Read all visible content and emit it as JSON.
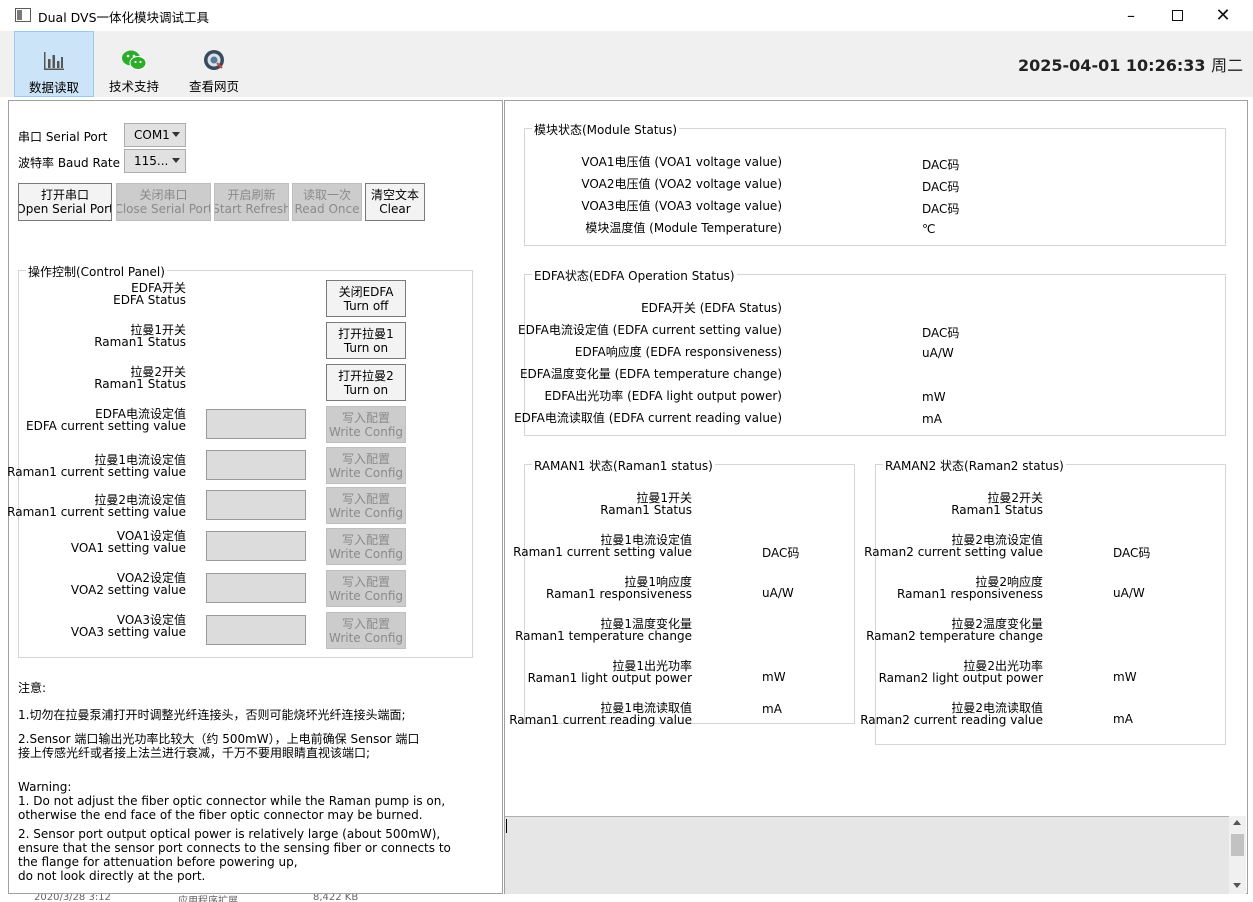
{
  "window": {
    "title": "Dual DVS一体化模块调试工具",
    "minimize_icon": "minimize-icon",
    "maximize_icon": "maximize-icon",
    "close_icon": "close-icon"
  },
  "toolbar": {
    "items": [
      {
        "label": "数据读取",
        "icon": "bar-chart-icon"
      },
      {
        "label": "技术支持",
        "icon": "wechat-icon"
      },
      {
        "label": "查看网页",
        "icon": "web-icon"
      }
    ],
    "datetime": "2025-04-01 10:26:33",
    "weekday": "周二"
  },
  "serial": {
    "port_label": "串口 Serial Port",
    "port_value": "COM1",
    "baud_label": "波特率 Baud Rate",
    "baud_value": "115...",
    "buttons": [
      {
        "cn": "打开串口",
        "en": "Open Serial Port",
        "enabled": true
      },
      {
        "cn": "关闭串口",
        "en": "Close Serial Port",
        "enabled": false
      },
      {
        "cn": "开启刷新",
        "en": "Start Refresh",
        "enabled": false
      },
      {
        "cn": "读取一次",
        "en": "Read Once",
        "enabled": false
      },
      {
        "cn": "清空文本",
        "en": "Clear",
        "enabled": true
      }
    ]
  },
  "control": {
    "title": "操作控制(Control Panel)",
    "toggles": [
      {
        "cn": "EDFA开关",
        "en": "EDFA Status",
        "btn_cn": "关闭EDFA",
        "btn_en": "Turn off"
      },
      {
        "cn": "拉曼1开关",
        "en": "Raman1 Status",
        "btn_cn": "打开拉曼1",
        "btn_en": "Turn on"
      },
      {
        "cn": "拉曼2开关",
        "en": "Raman1 Status",
        "btn_cn": "打开拉曼2",
        "btn_en": "Turn on"
      }
    ],
    "settings": [
      {
        "cn": "EDFA电流设定值",
        "en": "EDFA current setting value",
        "value": ""
      },
      {
        "cn": "拉曼1电流设定值",
        "en": "Raman1 current setting value",
        "value": ""
      },
      {
        "cn": "拉曼2电流设定值",
        "en": "Raman1 current setting value",
        "value": ""
      },
      {
        "cn": "VOA1设定值",
        "en": "VOA1 setting value",
        "value": ""
      },
      {
        "cn": "VOA2设定值",
        "en": "VOA2 setting value",
        "value": ""
      },
      {
        "cn": "VOA3设定值",
        "en": "VOA3 setting value",
        "value": ""
      }
    ],
    "write_cn": "写入配置",
    "write_en": "Write Config"
  },
  "notes": {
    "head": "注意:",
    "cn1": "1.切勿在拉曼泵浦打开时调整光纤连接头，否则可能烧坏光纤连接头端面;",
    "cn2a": "2.Sensor 端口输出光功率比较大（约 500mW），上电前确保 Sensor 端口",
    "cn2b": "接上传感光纤或者接上法兰进行衰减，千万不要用眼睛直视该端口;",
    "warn_head": "Warning:",
    "en1a": "1. Do not adjust the fiber optic connector while the Raman pump is on,",
    "en1b": " otherwise the end face of the fiber optic connector may be burned.",
    "en2a": "2. Sensor port output optical power is relatively large (about 500mW),",
    "en2b": " ensure that the sensor port connects to the sensing fiber or connects to",
    "en2c": " the flange for attenuation before powering up,",
    "en2d": " do not look directly at the port."
  },
  "module_status": {
    "title": "模块状态(Module Status)",
    "rows": [
      {
        "label": "VOA1电压值 (VOA1 voltage value)",
        "unit": "DAC码"
      },
      {
        "label": "VOA2电压值 (VOA2 voltage value)",
        "unit": "DAC码"
      },
      {
        "label": "VOA3电压值 (VOA3 voltage value)",
        "unit": "DAC码"
      },
      {
        "label": "模块温度值 (Module Temperature)",
        "unit": "℃"
      }
    ]
  },
  "edfa_status": {
    "title": "EDFA状态(EDFA Operation Status)",
    "rows": [
      {
        "label": "EDFA开关 (EDFA Status)",
        "unit": ""
      },
      {
        "label": "EDFA电流设定值 (EDFA current setting value)",
        "unit": "DAC码"
      },
      {
        "label": "EDFA响应度 (EDFA responsiveness)",
        "unit": "uA/W"
      },
      {
        "label": "EDFA温度变化量 (EDFA temperature change)",
        "unit": ""
      },
      {
        "label": "EDFA出光功率 (EDFA light output power)",
        "unit": "mW"
      },
      {
        "label": "EDFA电流读取值 (EDFA current reading value)",
        "unit": "mA"
      }
    ]
  },
  "raman1": {
    "title": "RAMAN1 状态(Raman1 status)",
    "rows": [
      {
        "cn": "拉曼1开关",
        "en": "Raman1 Status",
        "unit": ""
      },
      {
        "cn": "拉曼1电流设定值",
        "en": "Raman1 current setting value",
        "unit": "DAC码"
      },
      {
        "cn": "拉曼1响应度",
        "en": "Raman1 responsiveness",
        "unit": "uA/W"
      },
      {
        "cn": "拉曼1温度变化量",
        "en": "Raman1 temperature change",
        "unit": ""
      },
      {
        "cn": "拉曼1出光功率",
        "en": "Raman1 light output power",
        "unit": "mW"
      },
      {
        "cn": "拉曼1电流读取值",
        "en": "Raman1 current reading value",
        "unit": "mA"
      }
    ]
  },
  "raman2": {
    "title": "RAMAN2 状态(Raman2 status)",
    "rows": [
      {
        "cn": "拉曼2开关",
        "en": "Raman1 Status",
        "unit": ""
      },
      {
        "cn": "拉曼2电流设定值",
        "en": "Raman2 current setting value",
        "unit": "DAC码"
      },
      {
        "cn": "拉曼2响应度",
        "en": "Raman1 responsiveness",
        "unit": "uA/W"
      },
      {
        "cn": "拉曼2温度变化量",
        "en": "Raman2 temperature change",
        "unit": ""
      },
      {
        "cn": "拉曼2出光功率",
        "en": "Raman2 light output power",
        "unit": "mW"
      },
      {
        "cn": "拉曼2电流读取值",
        "en": "Raman2 current reading value",
        "unit": "mA"
      }
    ]
  },
  "log": {
    "text": ""
  },
  "background_strip": {
    "date": "2020/3/28 3:12",
    "type": "应用程序扩展",
    "size": "8,422 KB"
  }
}
